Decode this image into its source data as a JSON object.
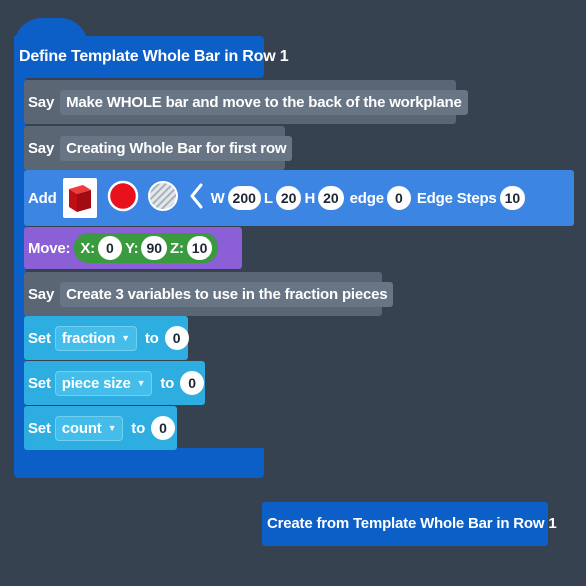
{
  "define_block": {
    "label": "Define Template Whole Bar in Row 1"
  },
  "say_blocks": [
    {
      "keyword": "Say",
      "text": "Make WHOLE bar and move to the back of the workplane"
    },
    {
      "keyword": "Say",
      "text": "Creating Whole Bar for first row"
    },
    {
      "keyword": "Say",
      "text": "Create 3 variables to use in the fraction pieces"
    }
  ],
  "add_block": {
    "keyword": "Add",
    "shape_icon": "red-cube-icon",
    "color_icon": "red-circle-icon",
    "texture_icon": "striped-circle-icon",
    "chevron_icon": "chevron-left-icon",
    "w_label": "W",
    "w_value": "200",
    "l_label": "L",
    "l_value": "20",
    "h_label": "H",
    "h_value": "20",
    "edge_label": "edge",
    "edge_value": "0",
    "edge_steps_label": "Edge Steps",
    "edge_steps_value": "10",
    "colors": {
      "cube": "#cf1019",
      "circle": "#e8111e"
    }
  },
  "move_block": {
    "keyword": "Move:",
    "x_label": "X:",
    "x_value": "0",
    "y_label": "Y:",
    "y_value": "90",
    "z_label": "Z:",
    "z_value": "10"
  },
  "set_blocks": [
    {
      "keyword": "Set",
      "variable": "fraction",
      "to_label": "to",
      "value": "0"
    },
    {
      "keyword": "Set",
      "variable": "piece size",
      "to_label": "to",
      "value": "0"
    },
    {
      "keyword": "Set",
      "variable": "count",
      "to_label": "to",
      "value": "0"
    }
  ],
  "create_block": {
    "label": "Create from Template Whole Bar in Row 1"
  },
  "colors": {
    "background": "#364250",
    "define": "#0d5fc8",
    "say": "#5a6674",
    "add": "#3d85e2",
    "move": "#8b5fd6",
    "set": "#2eaee0",
    "move_group": "#3a9a3e"
  }
}
